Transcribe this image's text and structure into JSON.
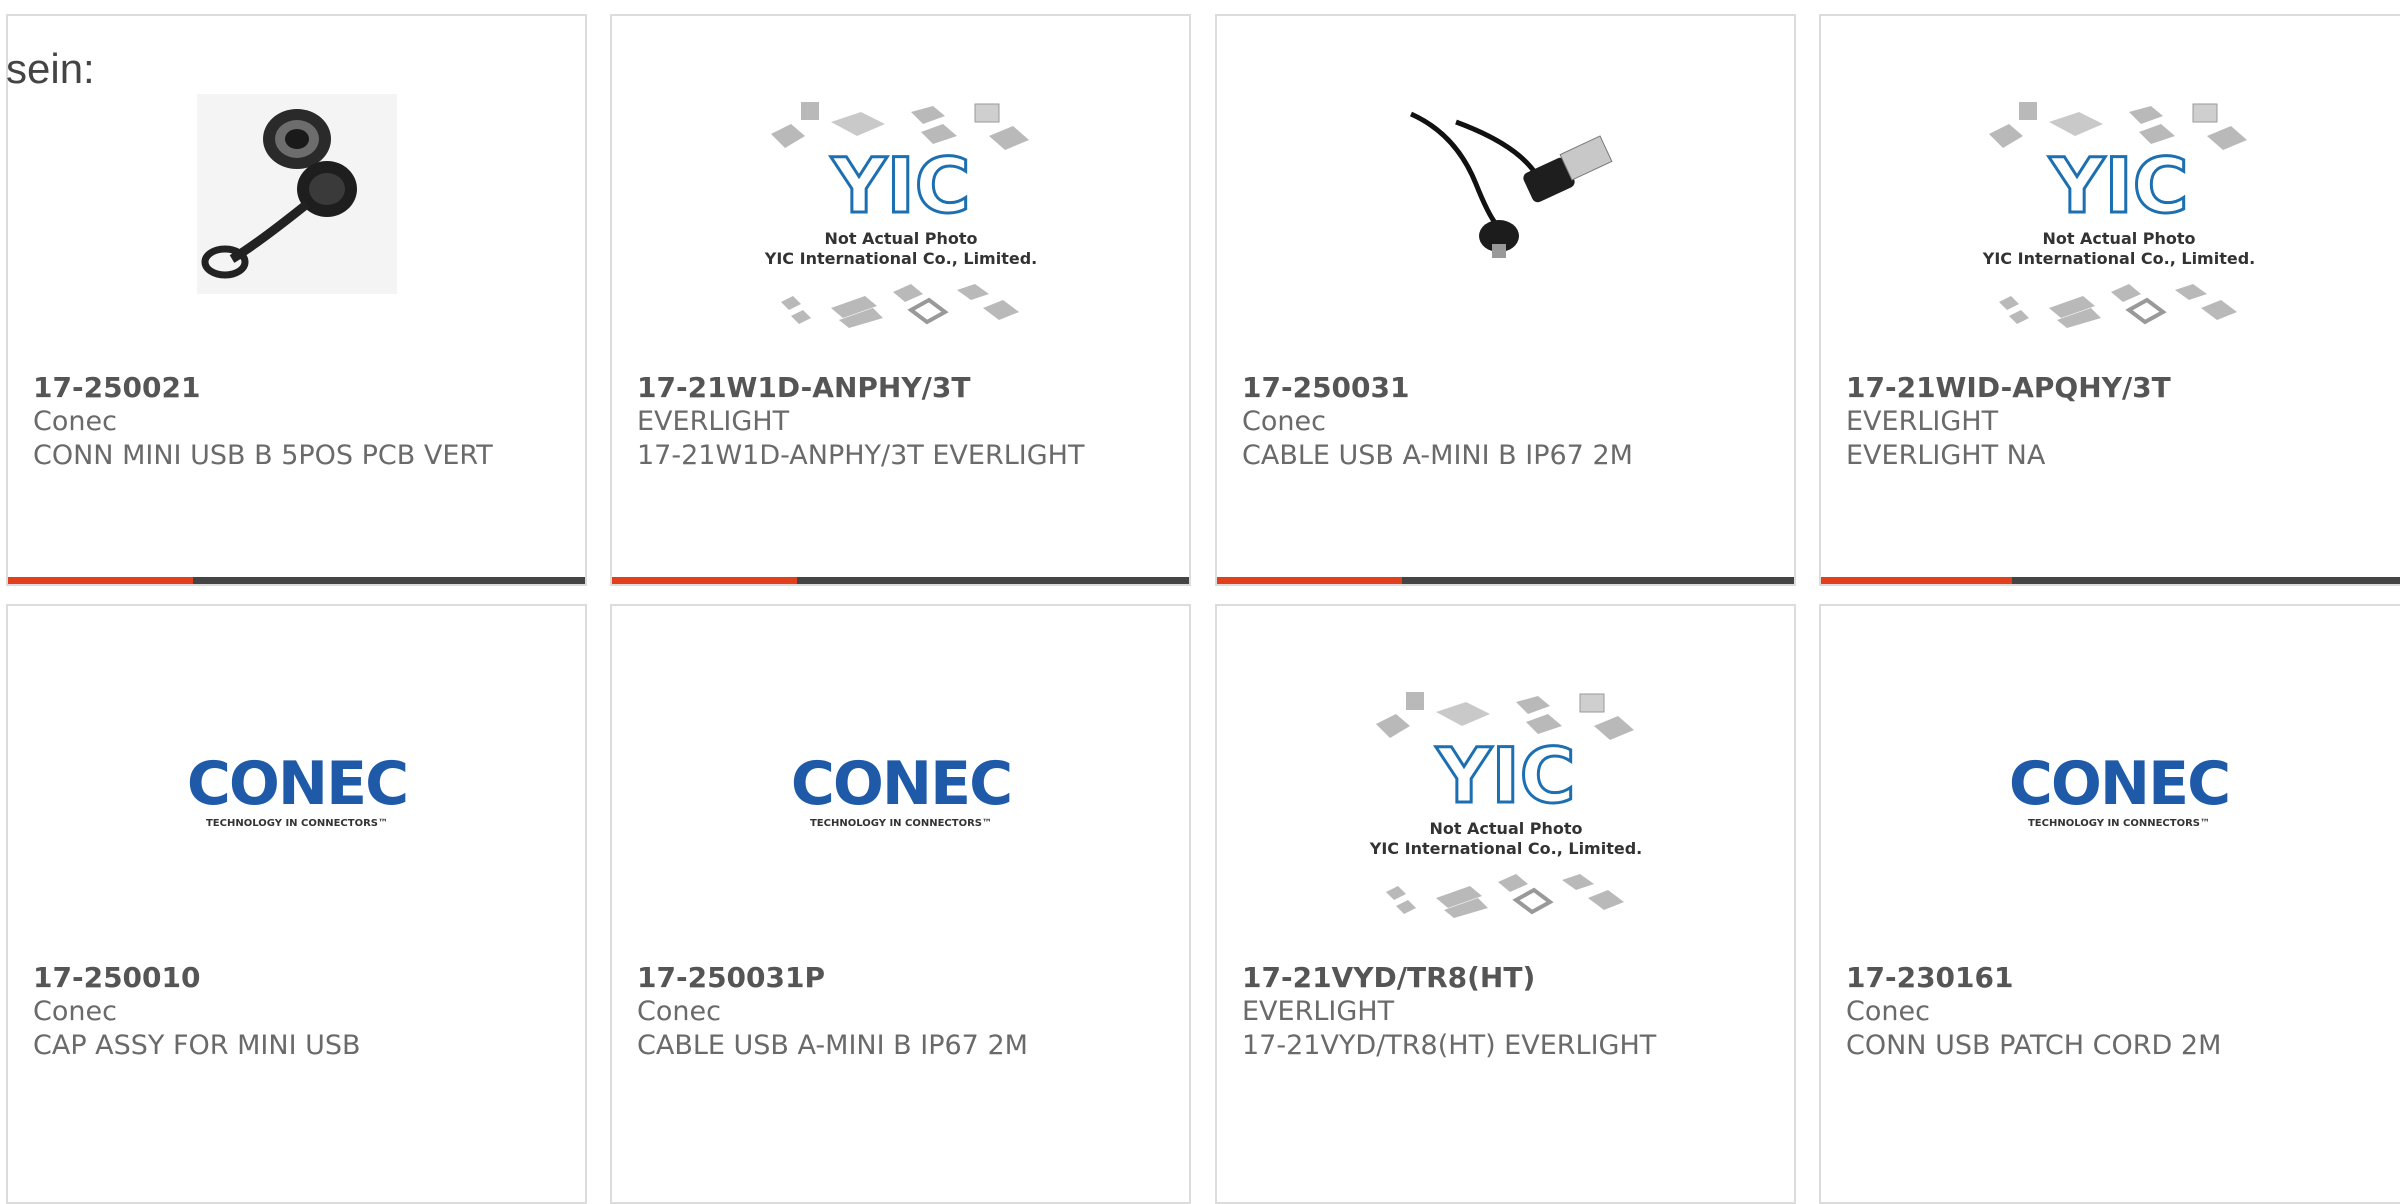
{
  "intro_text": "sein:",
  "colors": {
    "accent": "#e2401c",
    "bar_track": "#444444",
    "card_border": "#dcdcdc"
  },
  "products": [
    {
      "part": "17-250021",
      "manufacturer": "Conec",
      "description": "CONN MINI USB B 5POS PCB VERT",
      "image": "connector-with-cap-photo",
      "progress": 0.32
    },
    {
      "part": "17-21W1D-ANPHY/3T",
      "manufacturer": "EVERLIGHT",
      "description": "17-21W1D-ANPHY/3T EVERLIGHT",
      "image": "yic-not-actual-photo",
      "image_caption_1": "Not Actual Photo",
      "image_caption_2": "YIC International Co., Limited.",
      "image_logo": "YIC",
      "progress": 0.32
    },
    {
      "part": "17-250031",
      "manufacturer": "Conec",
      "description": "CABLE USB A-MINI B IP67 2M",
      "image": "usb-cable-photo",
      "progress": 0.32
    },
    {
      "part": "17-21WID-APQHY/3T",
      "manufacturer": "EVERLIGHT",
      "description": "EVERLIGHT NA",
      "image": "yic-not-actual-photo",
      "image_caption_1": "Not Actual Photo",
      "image_caption_2": "YIC International Co., Limited.",
      "image_logo": "YIC",
      "progress": 0.32
    },
    {
      "part": "17-250010",
      "manufacturer": "Conec",
      "description": "CAP ASSY FOR MINI USB",
      "image": "conec-logo",
      "image_logo": "CONEC",
      "image_tagline": "TECHNOLOGY IN CONNECTORS™"
    },
    {
      "part": "17-250031P",
      "manufacturer": "Conec",
      "description": "CABLE USB A-MINI B IP67 2M",
      "image": "conec-logo",
      "image_logo": "CONEC",
      "image_tagline": "TECHNOLOGY IN CONNECTORS™"
    },
    {
      "part": "17-21VYD/TR8(HT)",
      "manufacturer": "EVERLIGHT",
      "description": "17-21VYD/TR8(HT) EVERLIGHT",
      "image": "yic-not-actual-photo",
      "image_caption_1": "Not Actual Photo",
      "image_caption_2": "YIC International Co., Limited.",
      "image_logo": "YIC"
    },
    {
      "part": "17-230161",
      "manufacturer": "Conec",
      "description": "CONN USB PATCH CORD 2M",
      "image": "conec-logo",
      "image_logo": "CONEC",
      "image_tagline": "TECHNOLOGY IN CONNECTORS™"
    }
  ]
}
